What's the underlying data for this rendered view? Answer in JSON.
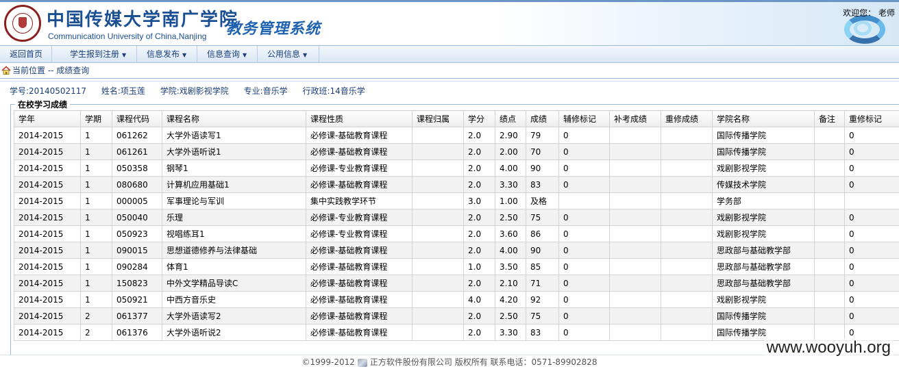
{
  "header": {
    "university_cn": "中国传媒大学南广学院",
    "university_en": "Communication University of China,Nanjing",
    "system_name": "教务管理系统",
    "welcome": "欢迎您：  老师"
  },
  "nav": {
    "items": [
      {
        "label": "返回首页",
        "dropdown": false
      },
      {
        "label": "学生报到注册",
        "dropdown": true
      },
      {
        "label": "信息发布",
        "dropdown": true
      },
      {
        "label": "信息查询",
        "dropdown": true
      },
      {
        "label": "公用信息",
        "dropdown": true
      }
    ],
    "dropdown_glyph": "▼"
  },
  "breadcrumb": {
    "text": "当前位置 -- 成绩查询"
  },
  "student": {
    "id": "学号:20140502117",
    "name": "姓名:项玉莲",
    "college": "学院:戏剧影视学院",
    "major": "专业:音乐学",
    "class": "行政班:14音乐学"
  },
  "grades": {
    "legend": "在校学习成绩",
    "columns": [
      "学年",
      "学期",
      "课程代码",
      "课程名称",
      "课程性质",
      "课程归属",
      "学分",
      "绩点",
      "成绩",
      "辅修标记",
      "补考成绩",
      "重修成绩",
      "学院名称",
      "备注",
      "重修标记"
    ],
    "rows": [
      [
        "2014-2015",
        "1",
        "061262",
        "大学外语读写1",
        "必修课-基础教育课程",
        "",
        "2.0",
        "2.90",
        "79",
        "0",
        "",
        "",
        "国际传播学院",
        "",
        "0"
      ],
      [
        "2014-2015",
        "1",
        "061261",
        "大学外语听说1",
        "必修课-基础教育课程",
        "",
        "2.0",
        "2.00",
        "70",
        "0",
        "",
        "",
        "国际传播学院",
        "",
        "0"
      ],
      [
        "2014-2015",
        "1",
        "050358",
        "钢琴1",
        "必修课-专业教育课程",
        "",
        "2.0",
        "4.00",
        "90",
        "0",
        "",
        "",
        "戏剧影视学院",
        "",
        "0"
      ],
      [
        "2014-2015",
        "1",
        "080680",
        "计算机应用基础1",
        "必修课-基础教育课程",
        "",
        "2.0",
        "3.30",
        "83",
        "0",
        "",
        "",
        "传媒技术学院",
        "",
        "0"
      ],
      [
        "2014-2015",
        "1",
        "000005",
        "军事理论与军训",
        "集中实践教学环节",
        "",
        "3.0",
        "1.00",
        "及格",
        "",
        "",
        "",
        "学务部",
        "",
        ""
      ],
      [
        "2014-2015",
        "1",
        "050040",
        "乐理",
        "必修课-专业教育课程",
        "",
        "2.0",
        "2.50",
        "75",
        "0",
        "",
        "",
        "戏剧影视学院",
        "",
        "0"
      ],
      [
        "2014-2015",
        "1",
        "050923",
        "视唱练耳1",
        "必修课-专业教育课程",
        "",
        "2.0",
        "3.60",
        "86",
        "0",
        "",
        "",
        "戏剧影视学院",
        "",
        "0"
      ],
      [
        "2014-2015",
        "1",
        "090015",
        "思想道德修养与法律基础",
        "必修课-基础教育课程",
        "",
        "2.0",
        "4.00",
        "90",
        "0",
        "",
        "",
        "思政部与基础教学部",
        "",
        "0"
      ],
      [
        "2014-2015",
        "1",
        "090284",
        "体育1",
        "必修课-基础教育课程",
        "",
        "1.0",
        "3.50",
        "85",
        "0",
        "",
        "",
        "思政部与基础教学部",
        "",
        "0"
      ],
      [
        "2014-2015",
        "1",
        "150823",
        "中外文学精品导读C",
        "必修课-基础教育课程",
        "",
        "2.0",
        "2.10",
        "71",
        "0",
        "",
        "",
        "思政部与基础教学部",
        "",
        "0"
      ],
      [
        "2014-2015",
        "1",
        "050921",
        "中西方音乐史",
        "必修课-基础教育课程",
        "",
        "4.0",
        "4.20",
        "92",
        "0",
        "",
        "",
        "戏剧影视学院",
        "",
        "0"
      ],
      [
        "2014-2015",
        "2",
        "061377",
        "大学外语读写2",
        "必修课-基础教育课程",
        "",
        "2.0",
        "2.50",
        "75",
        "0",
        "",
        "",
        "国际传播学院",
        "",
        "0"
      ],
      [
        "2014-2015",
        "2",
        "061376",
        "大学外语听说2",
        "必修课-基础教育课程",
        "",
        "2.0",
        "3.30",
        "83",
        "0",
        "",
        "",
        "国际传播学院",
        "",
        "0"
      ]
    ]
  },
  "footer": {
    "copyright": "©1999-2012",
    "company": "正方软件股份有限公司 版权所有   联系电话：0571-89902828"
  },
  "watermark": "www.wooyuh.org",
  "colors": {
    "brand_blue": "#1a4f93",
    "nav_text": "#1a3f7a"
  }
}
